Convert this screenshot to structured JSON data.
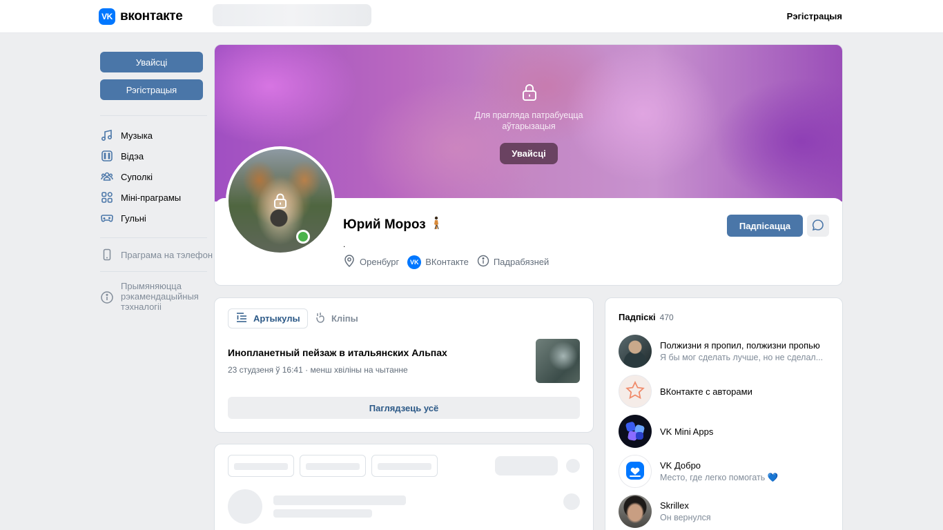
{
  "header": {
    "logo_mark": "VK",
    "logo_text": "вконтакте",
    "register_label": "Рэгістрацыя"
  },
  "sidebar": {
    "login_label": "Увайсці",
    "register_label": "Рэгістрацыя",
    "items": [
      {
        "label": "Музыка",
        "icon": "music-icon"
      },
      {
        "label": "Відэа",
        "icon": "video-icon"
      },
      {
        "label": "Суполкі",
        "icon": "groups-icon"
      },
      {
        "label": "Міні-праграмы",
        "icon": "apps-icon"
      },
      {
        "label": "Гульні",
        "icon": "gamepad-icon"
      }
    ],
    "phone_app": "Праграма на тэлефон",
    "recommendations": "Прымяняюцца рэкамендацыйныя тэхналогіі"
  },
  "profile": {
    "cover_text": "Для прагляда патрабуецца аўтарызацыя",
    "cover_login": "Увайсці",
    "name": "Юрий Мороз",
    "status": ".",
    "city": "Оренбург",
    "vk_link": "ВКонтакте",
    "details": "Падрабязней",
    "subscribe_label": "Падпісацца"
  },
  "articles": {
    "tab_articles": "Артыкулы",
    "tab_clips": "Кліпы",
    "title": "Инопланетный пейзаж в итальянских Альпах",
    "meta": "23 студзеня ў 16:41 · менш хвіліны на чытанне",
    "see_all": "Паглядзець усё"
  },
  "subscriptions": {
    "title": "Падпіскі",
    "count": "470",
    "items": [
      {
        "name": "Полжизни я пропил, полжизни пропью",
        "desc": "Я бы мог сделать лучше, но не сделал..."
      },
      {
        "name": "ВКонтакте с авторами",
        "desc": ""
      },
      {
        "name": "VK Mini Apps",
        "desc": ""
      },
      {
        "name": "VK Добро",
        "desc": "Место, где легко помогать 💙"
      },
      {
        "name": "Skrillex",
        "desc": "Он вернулся"
      }
    ]
  },
  "colors": {
    "accent": "#4a76a8",
    "vk_blue": "#0077ff",
    "online": "#4bb34b",
    "background": "#edeef0"
  }
}
